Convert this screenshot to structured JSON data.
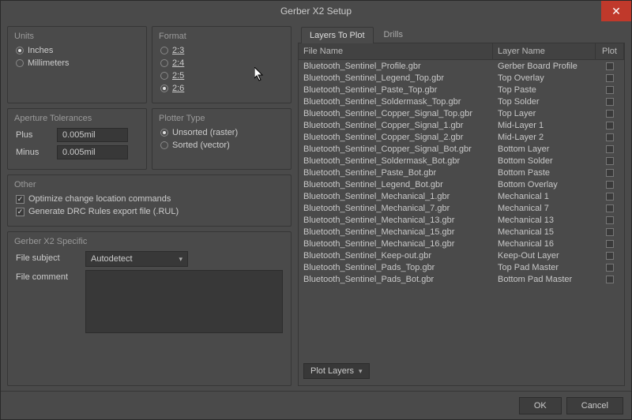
{
  "title": "Gerber X2 Setup",
  "units": {
    "title": "Units",
    "options": [
      {
        "label": "Inches",
        "selected": true
      },
      {
        "label": "Millimeters",
        "selected": false
      }
    ]
  },
  "format": {
    "title": "Format",
    "options": [
      {
        "label": "2:3",
        "selected": false
      },
      {
        "label": "2:4",
        "selected": false
      },
      {
        "label": "2:5",
        "selected": false
      },
      {
        "label": "2:6",
        "selected": true
      }
    ]
  },
  "aperture": {
    "title": "Aperture Tolerances",
    "plus_label": "Plus",
    "plus_value": "0.005mil",
    "minus_label": "Minus",
    "minus_value": "0.005mil"
  },
  "plotter": {
    "title": "Plotter Type",
    "options": [
      {
        "label": "Unsorted (raster)",
        "selected": true
      },
      {
        "label": "Sorted (vector)",
        "selected": false
      }
    ]
  },
  "other": {
    "title": "Other",
    "options": [
      {
        "label": "Optimize change location commands",
        "checked": true
      },
      {
        "label": "Generate DRC Rules export file (.RUL)",
        "checked": true
      }
    ]
  },
  "x2": {
    "title": "Gerber X2 Specific",
    "subject_label": "File subject",
    "subject_value": "Autodetect",
    "comment_label": "File comment",
    "comment_value": ""
  },
  "tabs": {
    "layers": "Layers To Plot",
    "drills": "Drills"
  },
  "table": {
    "headers": {
      "file": "File Name",
      "layer": "Layer Name",
      "plot": "Plot"
    },
    "rows": [
      {
        "file": "Bluetooth_Sentinel_Profile.gbr",
        "layer": "Gerber Board Profile"
      },
      {
        "file": "Bluetooth_Sentinel_Legend_Top.gbr",
        "layer": "Top Overlay"
      },
      {
        "file": "Bluetooth_Sentinel_Paste_Top.gbr",
        "layer": "Top Paste"
      },
      {
        "file": "Bluetooth_Sentinel_Soldermask_Top.gbr",
        "layer": "Top Solder"
      },
      {
        "file": "Bluetooth_Sentinel_Copper_Signal_Top.gbr",
        "layer": "Top Layer"
      },
      {
        "file": "Bluetooth_Sentinel_Copper_Signal_1.gbr",
        "layer": "Mid-Layer 1"
      },
      {
        "file": "Bluetooth_Sentinel_Copper_Signal_2.gbr",
        "layer": "Mid-Layer 2"
      },
      {
        "file": "Bluetooth_Sentinel_Copper_Signal_Bot.gbr",
        "layer": "Bottom Layer"
      },
      {
        "file": "Bluetooth_Sentinel_Soldermask_Bot.gbr",
        "layer": "Bottom Solder"
      },
      {
        "file": "Bluetooth_Sentinel_Paste_Bot.gbr",
        "layer": "Bottom Paste"
      },
      {
        "file": "Bluetooth_Sentinel_Legend_Bot.gbr",
        "layer": "Bottom Overlay"
      },
      {
        "file": "Bluetooth_Sentinel_Mechanical_1.gbr",
        "layer": "Mechanical 1"
      },
      {
        "file": "Bluetooth_Sentinel_Mechanical_7.gbr",
        "layer": "Mechanical 7"
      },
      {
        "file": "Bluetooth_Sentinel_Mechanical_13.gbr",
        "layer": "Mechanical 13"
      },
      {
        "file": "Bluetooth_Sentinel_Mechanical_15.gbr",
        "layer": "Mechanical 15"
      },
      {
        "file": "Bluetooth_Sentinel_Mechanical_16.gbr",
        "layer": "Mechanical 16"
      },
      {
        "file": "Bluetooth_Sentinel_Keep-out.gbr",
        "layer": "Keep-Out Layer"
      },
      {
        "file": "Bluetooth_Sentinel_Pads_Top.gbr",
        "layer": "Top Pad Master"
      },
      {
        "file": "Bluetooth_Sentinel_Pads_Bot.gbr",
        "layer": "Bottom Pad Master"
      }
    ],
    "plot_layers_btn": "Plot Layers"
  },
  "buttons": {
    "ok": "OK",
    "cancel": "Cancel"
  }
}
